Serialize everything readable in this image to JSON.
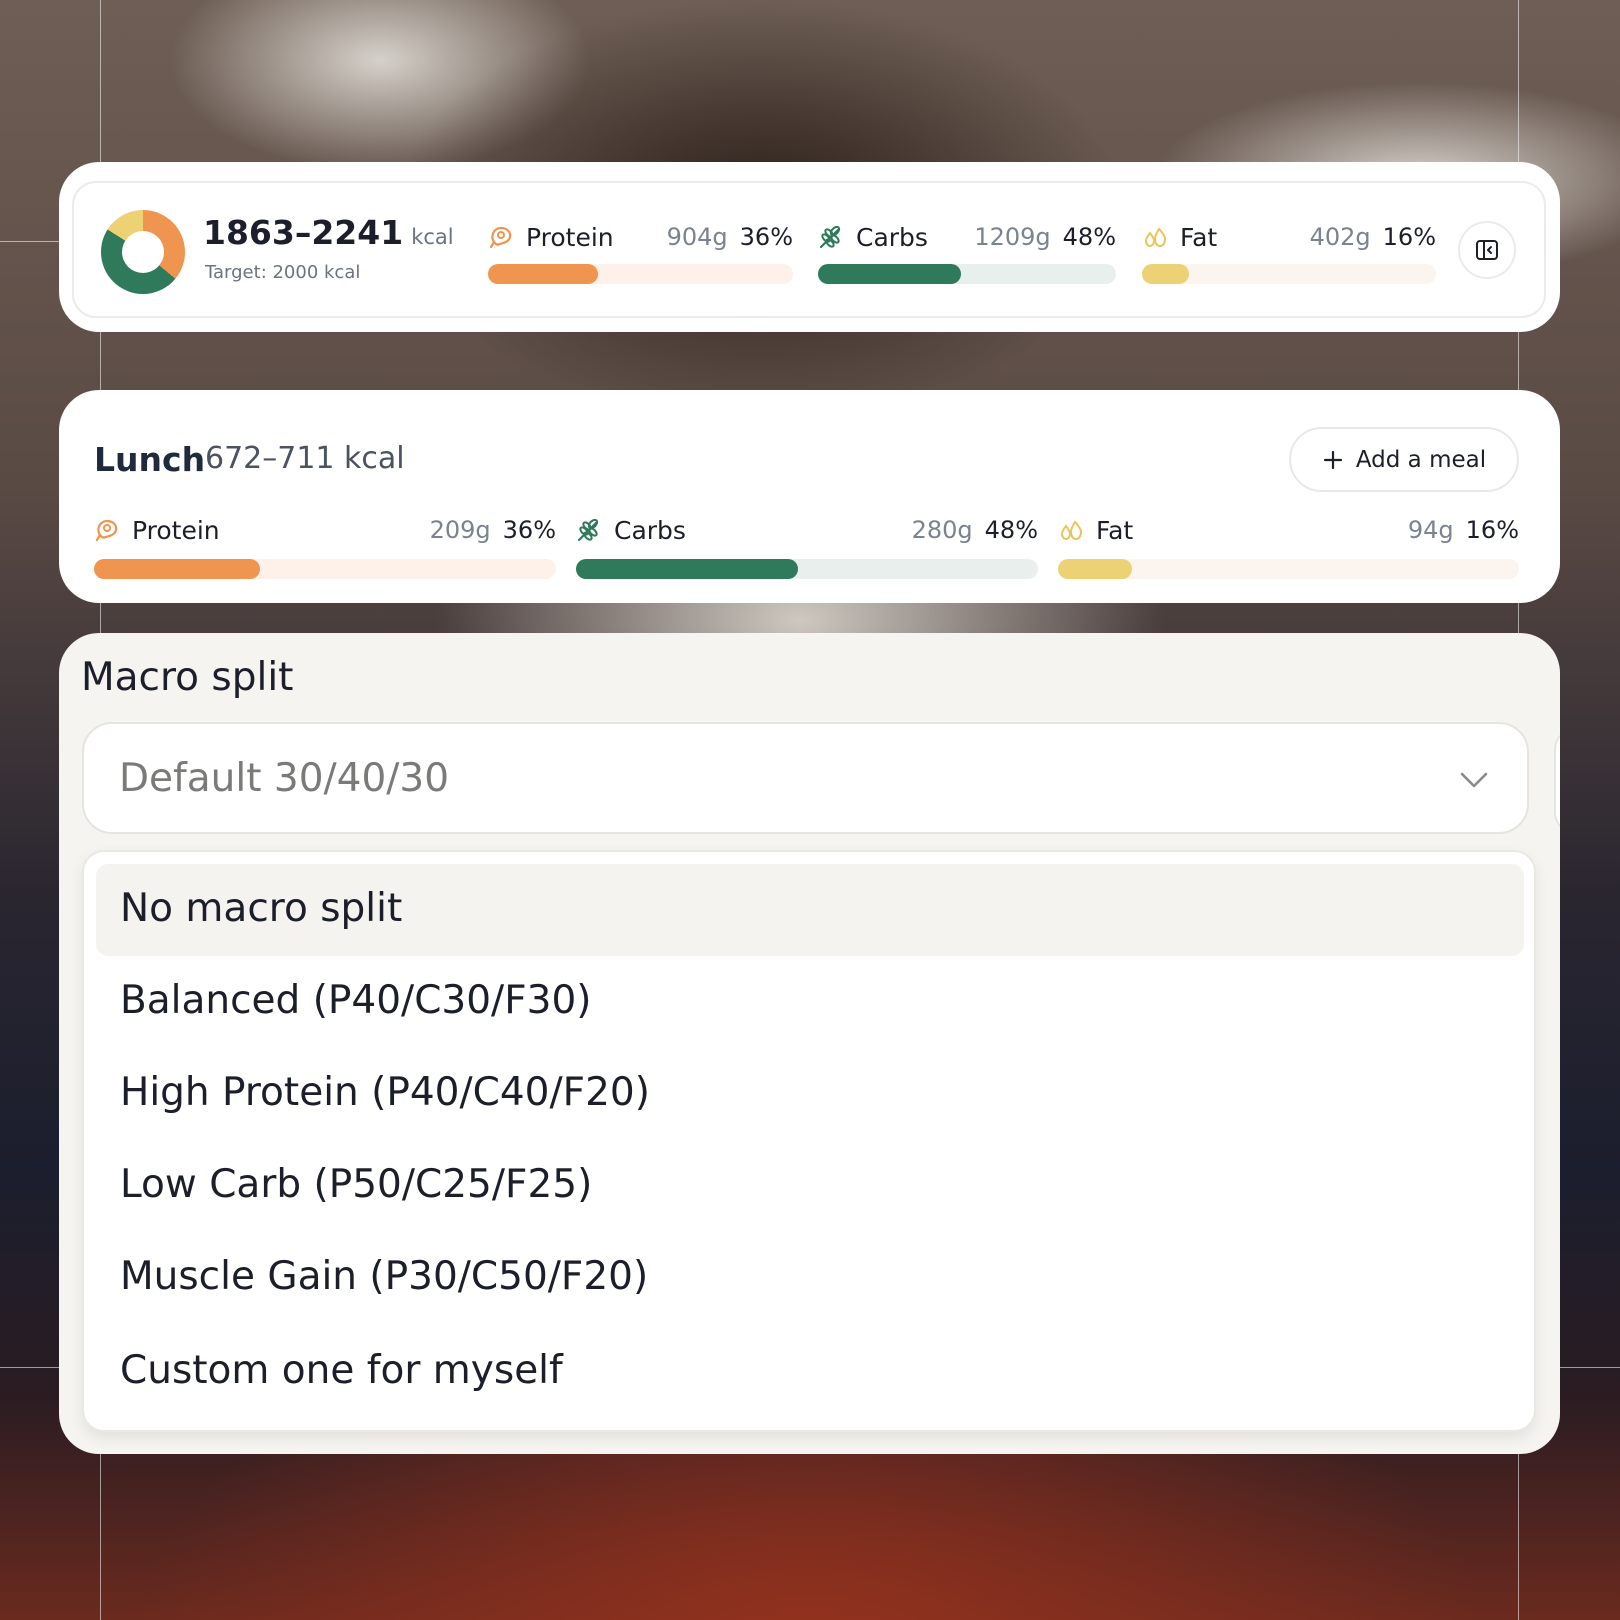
{
  "summary": {
    "kcal_range": "1863–2241",
    "kcal_unit": "kcal",
    "target_text": "Target: 2000 kcal",
    "donut_split": {
      "protein": 36,
      "carbs": 48,
      "fat": 16
    },
    "macros": [
      {
        "name": "Protein",
        "grams": "904g",
        "percent": "36%",
        "fill": 0.36,
        "icon": "meat-icon",
        "color": "#f0954f",
        "track": "#fdf1ea"
      },
      {
        "name": "Carbs",
        "grams": "1209g",
        "percent": "48%",
        "fill": 0.48,
        "icon": "wheat-icon",
        "color": "#2f7a5a",
        "track": "#e9efec"
      },
      {
        "name": "Fat",
        "grams": "402g",
        "percent": "16%",
        "fill": 0.16,
        "icon": "droplets-icon",
        "color": "#ecd274",
        "track": "#fcf5ef"
      }
    ],
    "collapse_icon": "panel-collapse-icon"
  },
  "lunch": {
    "title": "Lunch",
    "kcal": "672–711 kcal",
    "add_meal_label": "Add a meal",
    "add_icon": "plus-icon",
    "macros": [
      {
        "name": "Protein",
        "grams": "209g",
        "percent": "36%",
        "fill": 0.36,
        "icon": "meat-icon",
        "color": "#f0954f",
        "track": "#fdf1ea"
      },
      {
        "name": "Carbs",
        "grams": "280g",
        "percent": "48%",
        "fill": 0.48,
        "icon": "wheat-icon",
        "color": "#2f7a5a",
        "track": "#e9efec"
      },
      {
        "name": "Fat",
        "grams": "94g",
        "percent": "16%",
        "fill": 0.16,
        "icon": "droplets-icon",
        "color": "#ecd274",
        "track": "#fcf5ef"
      }
    ]
  },
  "macro_split": {
    "title": "Macro split",
    "selected_value": "Default 30/40/30",
    "chevron_icon": "chevron-down-icon",
    "options": [
      {
        "label": "No macro split",
        "highlighted": true
      },
      {
        "label": "Balanced (P40/C30/F30)",
        "highlighted": false
      },
      {
        "label": "High Protein (P40/C40/F20)",
        "highlighted": false
      },
      {
        "label": "Low Carb (P50/C25/F25)",
        "highlighted": false
      },
      {
        "label": "Muscle Gain (P30/C50/F20)",
        "highlighted": false
      },
      {
        "label": "Custom one for myself",
        "highlighted": false
      }
    ]
  }
}
